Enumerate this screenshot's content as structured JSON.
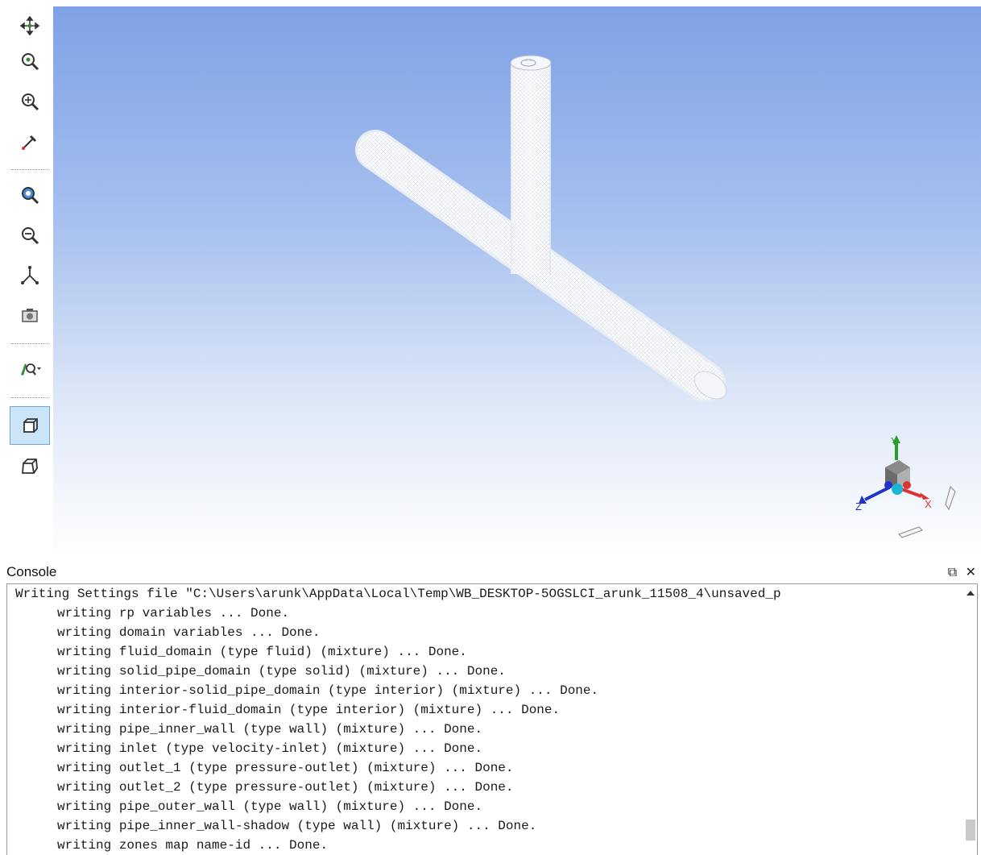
{
  "toolbar": {
    "tools": [
      {
        "name": "pan-icon"
      },
      {
        "name": "zoom-icon"
      },
      {
        "name": "zoom-box-icon"
      },
      {
        "name": "probe-icon"
      },
      {
        "name": "fit-to-window-icon"
      },
      {
        "name": "zoom-out-icon"
      },
      {
        "name": "axes-view-icon"
      },
      {
        "name": "snapshot-icon"
      },
      {
        "name": "lighting-icon"
      },
      {
        "name": "orthographic-projection-icon",
        "active": true
      },
      {
        "name": "perspective-projection-icon"
      }
    ]
  },
  "viewport": {
    "background_top": "#7ea2e6",
    "background_bottom": "#ffffff",
    "triad": {
      "x_label": "X",
      "y_label": "Y",
      "z_label": "Z"
    }
  },
  "console": {
    "title": "Console",
    "float_icon": "⧉",
    "close_icon": "✕",
    "lines": [
      "Writing Settings file \"C:\\Users\\arunk\\AppData\\Local\\Temp\\WB_DESKTOP-5OGSLCI_arunk_11508_4\\unsaved_p",
      "writing rp variables ... Done.",
      "writing domain variables ... Done.",
      "writing fluid_domain (type fluid) (mixture) ... Done.",
      "writing solid_pipe_domain (type solid) (mixture) ... Done.",
      "writing interior-solid_pipe_domain (type interior) (mixture) ... Done.",
      "writing interior-fluid_domain (type interior) (mixture) ... Done.",
      "writing pipe_inner_wall (type wall) (mixture) ... Done.",
      "writing inlet (type velocity-inlet) (mixture) ... Done.",
      "writing outlet_1 (type pressure-outlet) (mixture) ... Done.",
      "writing outlet_2 (type pressure-outlet) (mixture) ... Done.",
      "writing pipe_outer_wall (type wall) (mixture) ... Done.",
      "writing pipe_inner_wall-shadow (type wall) (mixture) ... Done.",
      "writing zones map name-id ... Done."
    ]
  }
}
